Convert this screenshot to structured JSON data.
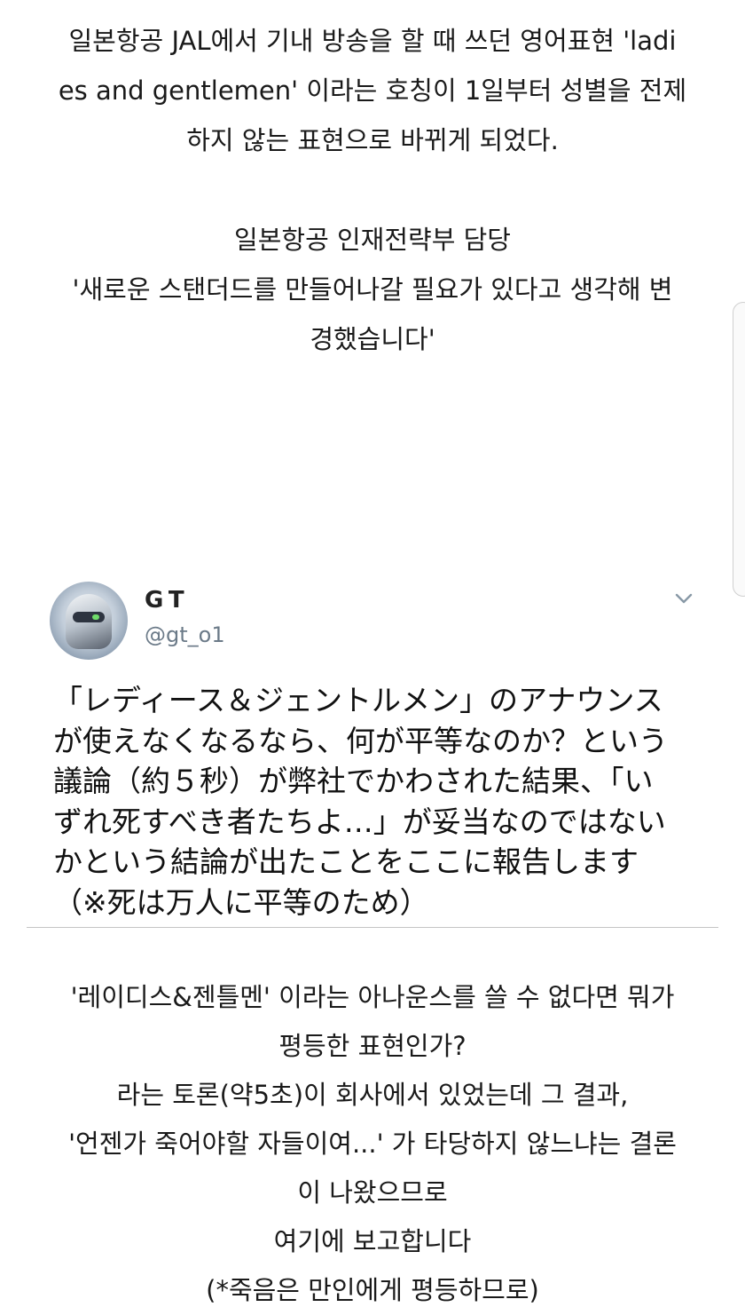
{
  "intro": {
    "lines": [
      "일본항공 JAL에서 기내 방송을 할 때 쓰던 영어표현 'ladi",
      "es and gentlemen' 이라는 호칭이 1일부터 성별을 전제",
      "하지 않는 표현으로 바뀌게 되었다.",
      "일본항공 인재전략부 담당",
      "'새로운 스탠더드를 만들어나갈 필요가 있다고 생각해 변",
      "경했습니다'"
    ]
  },
  "tweet": {
    "display_name": "GT",
    "handle": "@gt_o1",
    "menu_icon": "chevron-down-icon",
    "body_lines": [
      "「レディース＆ジェントルメン」のアナウンス",
      "が使えなくなるなら、何が平等なのか？という",
      "議論（約５秒）が弊社でかわされた結果、「い",
      "ずれ死すべき者たちよ…」が妥当なのではない",
      "かという結論が出たことをここに報告します",
      "（※死は万人に平等のため）"
    ]
  },
  "translation": {
    "lines": [
      "'레이디스&젠틀멘' 이라는 아나운스를 쓸 수 없다면 뭐가",
      "평등한 표현인가?",
      "라는 토론(약5초)이 회사에서 있었는데 그 결과,",
      "'언젠가 죽어야할 자들이여...' 가 타당하지 않느냐는 결론",
      "이 나왔으므로",
      "여기에 보고합니다",
      "(*죽음은 만인에게 평등하므로)"
    ]
  },
  "colors": {
    "text": "#1a1a1a",
    "handle": "#6b7a88",
    "divider": "#c4c4c4",
    "chevron": "#8899a6"
  }
}
